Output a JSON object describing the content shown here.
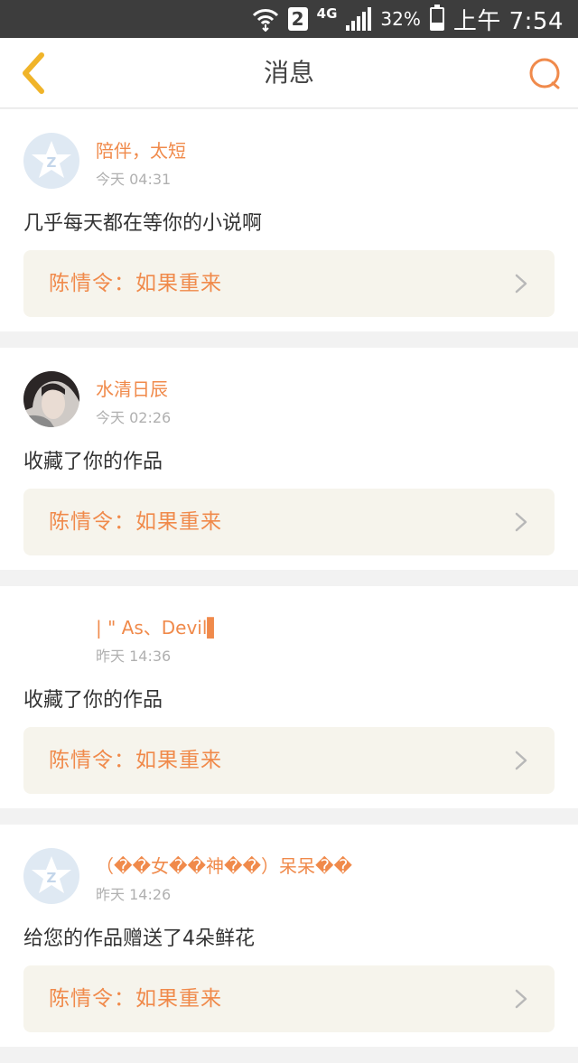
{
  "status_bar": {
    "sim_slot": "2",
    "network_type": "4G",
    "battery_percent": "32%",
    "battery_level": 0.32,
    "time": "上午 7:54"
  },
  "header": {
    "title": "消息"
  },
  "messages": [
    {
      "username": "陪伴，太短",
      "time": "今天 04:31",
      "text": "几乎每天都在等你的小说啊",
      "work": "陈情令：如果重来",
      "avatar": "default-avatar-icon"
    },
    {
      "username": "水清日辰",
      "time": "今天 02:26",
      "text": "收藏了你的作品",
      "work": "陈情令：如果重来",
      "avatar": "photo-avatar"
    },
    {
      "username": "| \" As、Devil▌",
      "time": "昨天 14:36",
      "text": "收藏了你的作品",
      "work": "陈情令：如果重来",
      "avatar": "blank-avatar"
    },
    {
      "username": "（��女��神��）呆呆��",
      "time": "昨天 14:26",
      "text": "给您的作品赠送了4朵鲜花",
      "work": "陈情令：如果重来",
      "avatar": "default-avatar-icon"
    }
  ],
  "colors": {
    "accent": "#f08a4b",
    "back_icon": "#f0b429",
    "card_link_bg": "#f6f4ec",
    "status_bar_bg": "#3d3d3d"
  }
}
